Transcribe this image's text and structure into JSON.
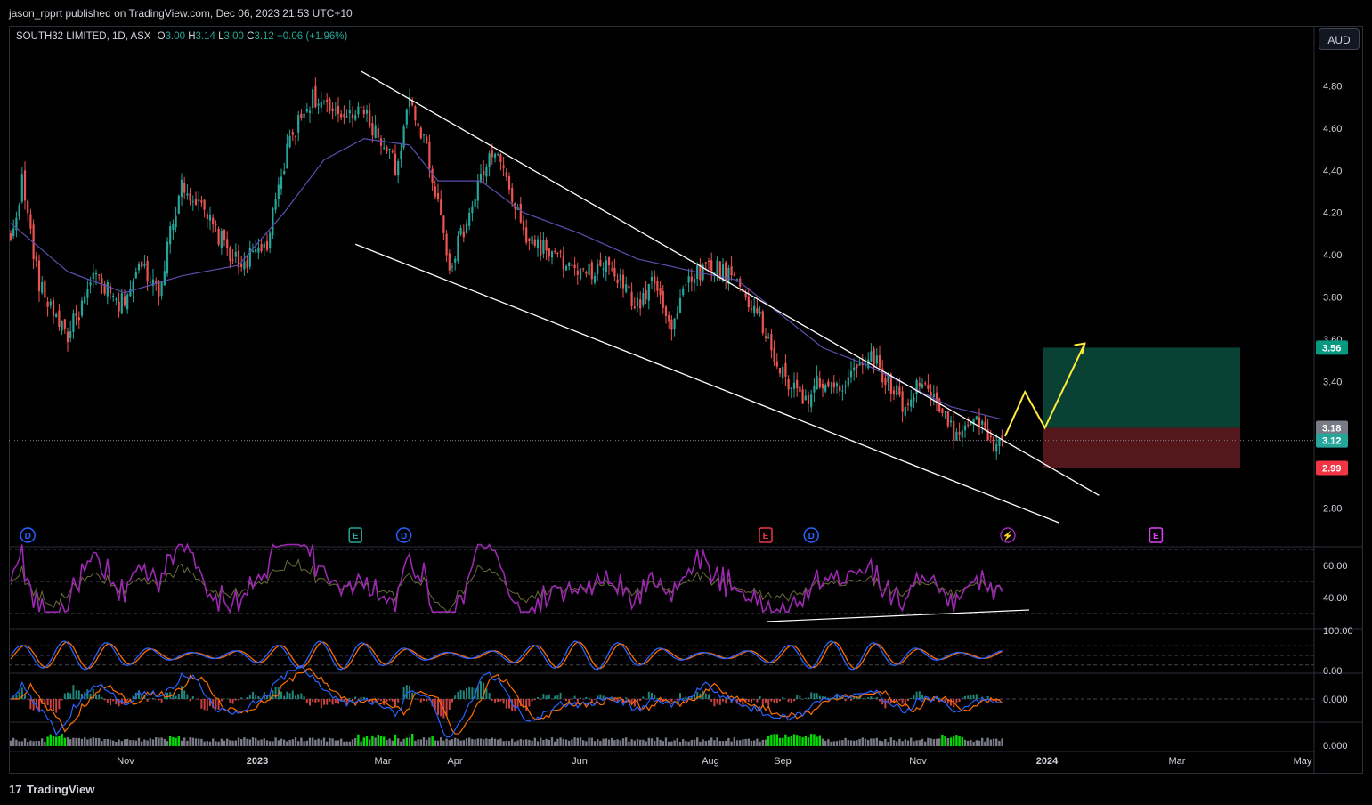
{
  "header": {
    "publisher_text": "jason_rpprt published on TradingView.com, Dec 06, 2023 21:53 UTC+10"
  },
  "symbol": {
    "name": "SOUTH32 LIMITED, 1D, ASX",
    "open_label": "O",
    "open": "3.00",
    "high_label": "H",
    "high": "3.14",
    "low_label": "L",
    "low": "3.00",
    "close_label": "C",
    "close": "3.12",
    "change": "+0.06 (+1.96%)"
  },
  "currency_button": "AUD",
  "footer": {
    "brand": "TradingView",
    "logo_glyph": "17"
  },
  "colors": {
    "up": "#26a69a",
    "down": "#ef5350",
    "ma": "#5b4fb0",
    "rsi": "#9c27b0",
    "stoch_k": "#2962ff",
    "stoch_d": "#ff6d00",
    "target_zone": "#0b4d3e",
    "stop_zone": "#5c1a1f",
    "projection": "#ffeb3b",
    "channel": "#ffffff",
    "volume": "#787b86",
    "volume_high": "#00e000"
  },
  "chart_data": {
    "type": "candlestick",
    "title": "SOUTH32 LIMITED, 1D, ASX",
    "price_axis": {
      "ticks": [
        "4.80",
        "4.60",
        "4.40",
        "4.20",
        "4.00",
        "3.80",
        "3.60",
        "3.40",
        "2.80"
      ],
      "ylim": [
        2.68,
        4.99
      ]
    },
    "time_axis": {
      "ticks": [
        "Nov",
        "2023",
        "Mar",
        "Apr",
        "Jun",
        "Aug",
        "Sep",
        "Nov",
        "2024",
        "Mar",
        "May"
      ]
    },
    "last_price": 3.12,
    "price_tags": [
      {
        "label": "3.56",
        "value": 3.56,
        "color": "#089981"
      },
      {
        "label": "3.18",
        "value": 3.18,
        "color": "#787b86"
      },
      {
        "label": "3.12",
        "value": 3.12,
        "color": "#26a69a"
      },
      {
        "label": "2.99",
        "value": 2.99,
        "color": "#f23645"
      }
    ],
    "anchor_closes": [
      [
        0,
        4.05
      ],
      [
        4,
        4.35
      ],
      [
        10,
        3.85
      ],
      [
        20,
        3.62
      ],
      [
        30,
        3.9
      ],
      [
        38,
        3.75
      ],
      [
        46,
        3.95
      ],
      [
        52,
        3.84
      ],
      [
        60,
        4.35
      ],
      [
        70,
        4.15
      ],
      [
        80,
        3.95
      ],
      [
        90,
        4.05
      ],
      [
        98,
        4.55
      ],
      [
        106,
        4.75
      ],
      [
        114,
        4.65
      ],
      [
        122,
        4.7
      ],
      [
        130,
        4.55
      ],
      [
        136,
        4.4
      ],
      [
        140,
        4.75
      ],
      [
        146,
        4.5
      ],
      [
        150,
        4.25
      ],
      [
        154,
        3.95
      ],
      [
        160,
        4.15
      ],
      [
        166,
        4.4
      ],
      [
        170,
        4.5
      ],
      [
        174,
        4.35
      ],
      [
        180,
        4.1
      ],
      [
        190,
        4.0
      ],
      [
        200,
        3.9
      ],
      [
        210,
        3.95
      ],
      [
        220,
        3.75
      ],
      [
        226,
        3.9
      ],
      [
        232,
        3.65
      ],
      [
        238,
        3.9
      ],
      [
        246,
        3.95
      ],
      [
        254,
        3.9
      ],
      [
        262,
        3.72
      ],
      [
        270,
        3.45
      ],
      [
        278,
        3.3
      ],
      [
        284,
        3.4
      ],
      [
        290,
        3.35
      ],
      [
        296,
        3.48
      ],
      [
        302,
        3.52
      ],
      [
        308,
        3.4
      ],
      [
        314,
        3.28
      ],
      [
        320,
        3.42
      ],
      [
        326,
        3.25
      ],
      [
        332,
        3.15
      ],
      [
        338,
        3.25
      ],
      [
        344,
        3.1
      ],
      [
        348,
        3.12
      ]
    ],
    "ma_series": [
      [
        0,
        4.15
      ],
      [
        20,
        3.92
      ],
      [
        40,
        3.82
      ],
      [
        60,
        3.9
      ],
      [
        80,
        3.95
      ],
      [
        96,
        4.2
      ],
      [
        110,
        4.45
      ],
      [
        124,
        4.55
      ],
      [
        140,
        4.52
      ],
      [
        150,
        4.35
      ],
      [
        165,
        4.35
      ],
      [
        180,
        4.2
      ],
      [
        200,
        4.1
      ],
      [
        220,
        3.98
      ],
      [
        240,
        3.92
      ],
      [
        255,
        3.88
      ],
      [
        270,
        3.72
      ],
      [
        285,
        3.56
      ],
      [
        300,
        3.48
      ],
      [
        315,
        3.38
      ],
      [
        330,
        3.28
      ],
      [
        348,
        3.22
      ]
    ],
    "falling_wedge": {
      "upper": {
        "from": [
          123,
          4.87
        ],
        "to": [
          382,
          2.86
        ]
      },
      "lower": {
        "from": [
          121,
          4.05
        ],
        "to": [
          368,
          2.73
        ]
      },
      "support": {
        "from": [
          267,
          2.86
        ],
        "to": [
          362,
          2.72
        ]
      }
    },
    "trade_setup": {
      "entry": 3.18,
      "target": 3.56,
      "stop": 2.99,
      "projection_path": [
        [
          349,
          3.14
        ],
        [
          356,
          3.35
        ],
        [
          363,
          3.18
        ],
        [
          377,
          3.58
        ]
      ]
    },
    "events": [
      {
        "label": "D",
        "kind": "dividend",
        "bar": 6
      },
      {
        "label": "E",
        "kind": "earnings",
        "bar": 121
      },
      {
        "label": "D",
        "kind": "dividend",
        "bar": 138
      },
      {
        "label": "E",
        "kind": "earnings",
        "bar": 265
      },
      {
        "label": "D",
        "kind": "dividend",
        "bar": 281
      },
      {
        "label": "⚡",
        "kind": "split",
        "bar": 350
      },
      {
        "label": "E",
        "kind": "earnings",
        "bar": 402
      }
    ],
    "rsi": {
      "ticks": [
        "60.00",
        "40.00"
      ],
      "ylim": [
        20,
        76
      ]
    },
    "stoch": {
      "ticks": [
        "100.00",
        "0.00"
      ]
    },
    "macd": {
      "ticks": [
        "0.000"
      ]
    },
    "volume": {
      "ticks": [
        "0.000"
      ]
    }
  }
}
